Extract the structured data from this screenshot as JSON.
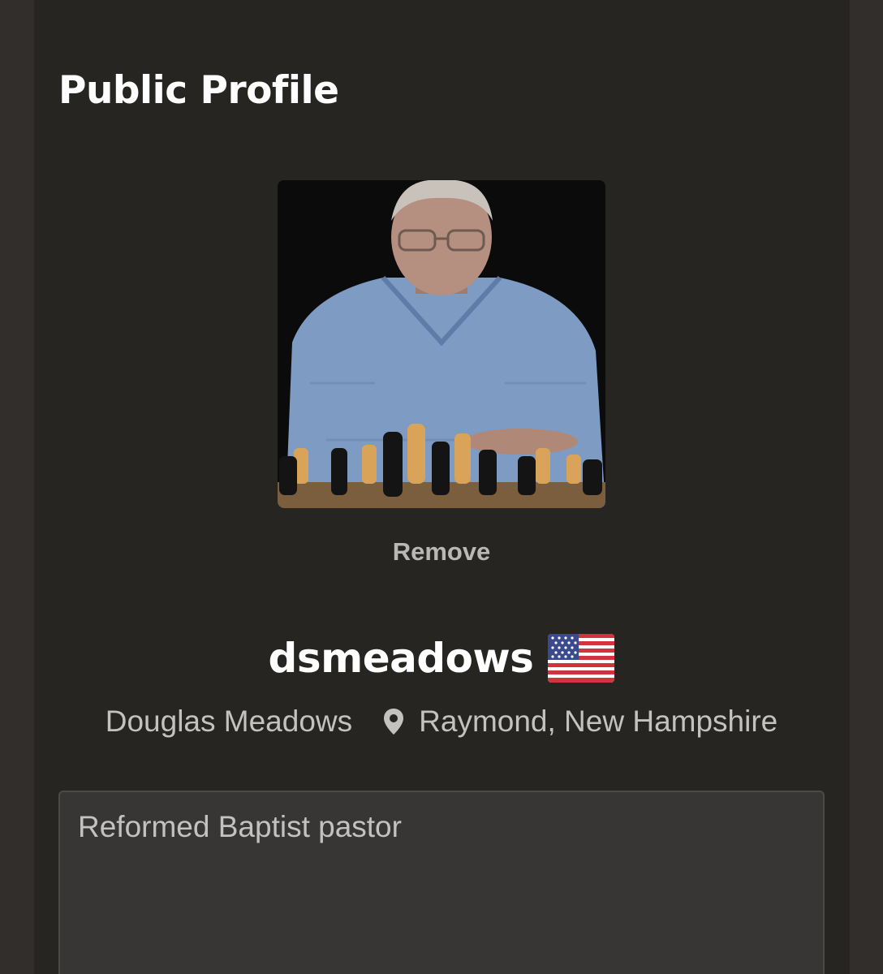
{
  "section": {
    "title": "Public Profile"
  },
  "avatar": {
    "remove_label": "Remove"
  },
  "profile": {
    "username": "dsmeadows",
    "country_flag_icon": "us-flag-icon",
    "full_name": "Douglas Meadows",
    "location_icon": "location-pin-icon",
    "location": "Raymond, New Hampshire",
    "bio": "Reformed Baptist pastor"
  },
  "colors": {
    "background": "#312e2b",
    "panel": "#262522",
    "bio_field": "#383634",
    "text_primary": "#ffffff",
    "text_secondary": "#c3c2c0"
  }
}
